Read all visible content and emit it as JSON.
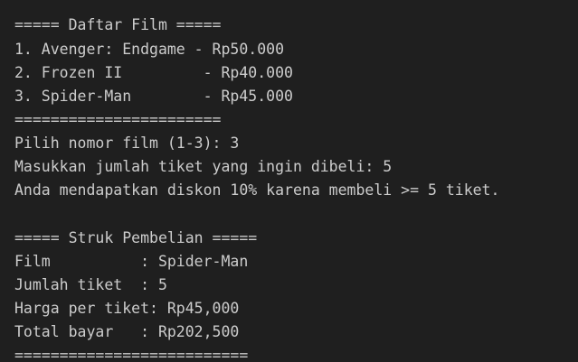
{
  "terminal": {
    "lines": [
      "===== Daftar Film =====",
      "1. Avenger: Endgame - Rp50.000",
      "2. Frozen II         - Rp40.000",
      "3. Spider-Man        - Rp45.000",
      "=======================",
      "Pilih nomor film (1-3): 3",
      "Masukkan jumlah tiket yang ingin dibeli: 5",
      "Anda mendapatkan diskon 10% karena membeli >= 5 tiket.",
      "",
      "===== Struk Pembelian =====",
      "Film          : Spider-Man",
      "Jumlah tiket  : 5",
      "Harga per tiket: Rp45,000",
      "Total bayar   : Rp202,500",
      "=========================="
    ]
  }
}
